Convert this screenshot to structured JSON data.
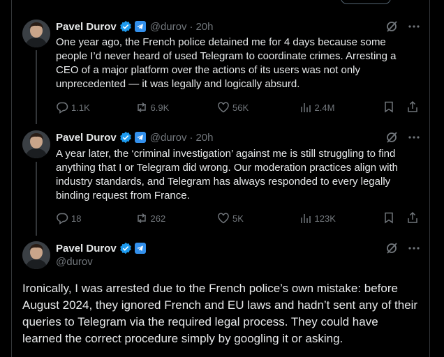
{
  "colors": {
    "background": "#000000",
    "text": "#e7e9ea",
    "muted": "#71767b",
    "verified": "#1d9bf0",
    "affiliate": "#3390ec",
    "thread_line": "#333639"
  },
  "tweets": [
    {
      "author": "Pavel Durov",
      "handle": "@durov",
      "dot": "·",
      "time": "20h",
      "text": "One year ago, the French police detained me for 4 days because some people I’d never heard of used Telegram to coordinate crimes. Arresting a CEO of a major platform over the actions of its users was not only unprecedented — it was legally and logically absurd.",
      "stats": {
        "replies": "1.1K",
        "reposts": "6.9K",
        "likes": "56K",
        "views": "2.4M"
      }
    },
    {
      "author": "Pavel Durov",
      "handle": "@durov",
      "dot": "·",
      "time": "20h",
      "text": "A year later, the ‘criminal investigation’ against me is still struggling to find anything that I or Telegram did wrong. Our moderation practices align with industry standards, and Telegram has always responded to every legally binding request from France.",
      "stats": {
        "replies": "18",
        "reposts": "262",
        "likes": "5K",
        "views": "123K"
      }
    },
    {
      "author": "Pavel Durov",
      "handle": "@durov",
      "text": "Ironically, I was arrested due to the French police’s own mistake: before August 2024, they ignored French and EU laws and hadn’t sent any of their queries to Telegram via the required legal process. They could have learned the correct procedure simply by googling it or asking."
    }
  ],
  "icons": {
    "grok": "grok-icon",
    "more": "more-icon",
    "reply": "reply-icon",
    "repost": "repost-icon",
    "like": "like-icon",
    "views": "views-icon",
    "bookmark": "bookmark-icon",
    "share": "share-icon"
  }
}
